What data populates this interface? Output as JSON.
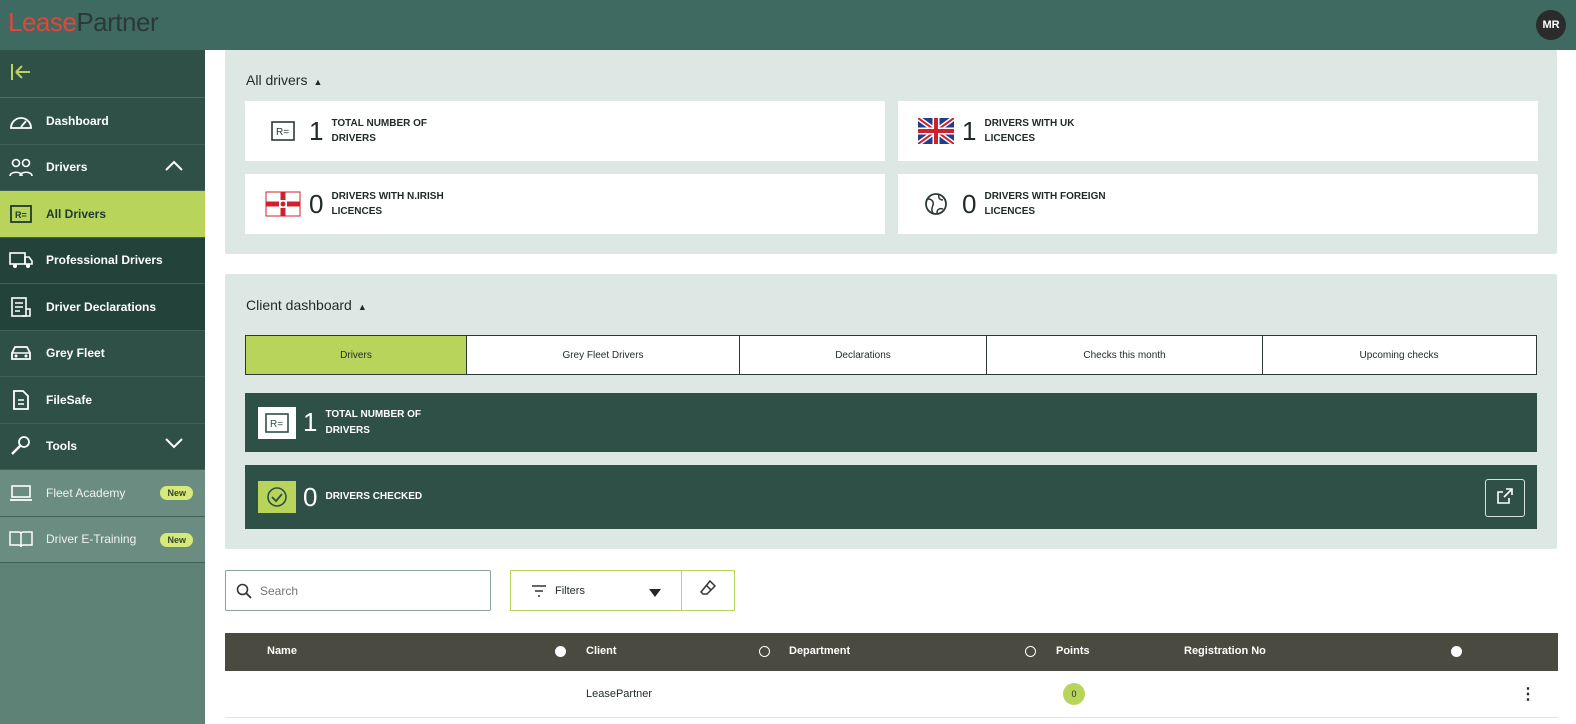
{
  "brand": {
    "logo_part1": "Lease",
    "logo_part2": "Partner",
    "user_initials": "MR"
  },
  "sidebar": {
    "items": [
      {
        "label": "Dashboard"
      },
      {
        "label": "Drivers"
      },
      {
        "label": "All Drivers"
      },
      {
        "label": "Professional Drivers"
      },
      {
        "label": "Driver Declarations"
      },
      {
        "label": "Grey Fleet"
      },
      {
        "label": "FileSafe"
      },
      {
        "label": "Tools"
      },
      {
        "label": "Fleet Academy",
        "badge": "New"
      },
      {
        "label": "Driver E-Training",
        "badge": "New"
      }
    ]
  },
  "all_drivers": {
    "title": "All drivers",
    "stats": [
      {
        "value": "1",
        "label": "TOTAL NUMBER OF DRIVERS"
      },
      {
        "value": "1",
        "label": "DRIVERS WITH UK LICENCES"
      },
      {
        "value": "0",
        "label": "DRIVERS WITH N.IRISH LICENCES"
      },
      {
        "value": "0",
        "label": "DRIVERS WITH FOREIGN LICENCES"
      }
    ]
  },
  "client_dashboard": {
    "title": "Client dashboard",
    "tabs": [
      {
        "label": "Drivers"
      },
      {
        "label": "Grey Fleet Drivers"
      },
      {
        "label": "Declarations"
      },
      {
        "label": "Checks this month"
      },
      {
        "label": "Upcoming checks"
      }
    ],
    "cards": [
      {
        "value": "1",
        "label": "TOTAL NUMBER OF DRIVERS"
      },
      {
        "value": "0",
        "label": "DRIVERS CHECKED"
      }
    ]
  },
  "toolbar": {
    "search_placeholder": "Search",
    "filters_label": "Filters"
  },
  "table": {
    "columns": [
      "Name",
      "Client",
      "Department",
      "Points",
      "Registration No"
    ],
    "rows": [
      {
        "name": "",
        "client": "LeasePartner",
        "department": "",
        "points": "0",
        "registration": ""
      }
    ]
  },
  "colors": {
    "accent": "#b8d45a",
    "dark_green": "#2f5047",
    "topbar": "#3f6a61",
    "logo_red": "#e0463a"
  }
}
